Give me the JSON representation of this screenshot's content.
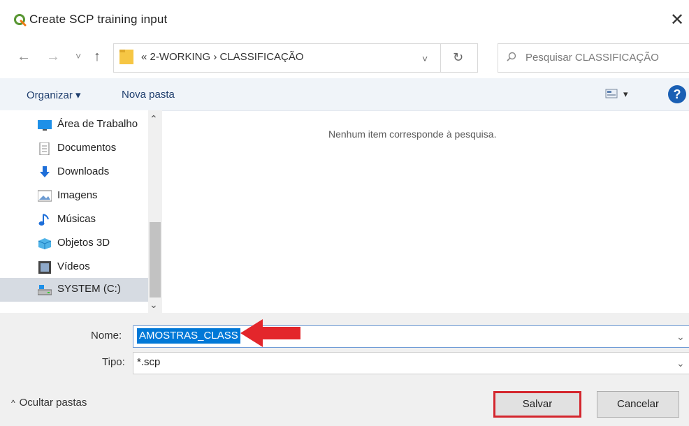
{
  "window": {
    "title": "Create SCP training input",
    "close_glyph": "✕"
  },
  "nav": {
    "back": "←",
    "forward": "→",
    "recent": "˅",
    "up": "↑"
  },
  "address": {
    "breadcrumb": "« 2-WORKING  ›  CLASSIFICAÇÃO",
    "dropdown_glyph": "˅",
    "refresh_glyph": "↻",
    "search_placeholder": "Pesquisar CLASSIFICAÇÃO"
  },
  "toolbar": {
    "organize_label": "Organizar ▾",
    "new_folder_label": "Nova pasta",
    "view_dropdown": "▾",
    "help_glyph": "?"
  },
  "sidebar": {
    "items": [
      {
        "label": "Área de Trabalho",
        "icon": "desktop-icon"
      },
      {
        "label": "Documentos",
        "icon": "documents-icon"
      },
      {
        "label": "Downloads",
        "icon": "downloads-icon"
      },
      {
        "label": "Imagens",
        "icon": "images-icon"
      },
      {
        "label": "Músicas",
        "icon": "music-icon"
      },
      {
        "label": "Objetos 3D",
        "icon": "objects-3d-icon"
      },
      {
        "label": "Vídeos",
        "icon": "videos-icon"
      },
      {
        "label": "SYSTEM (C:)",
        "icon": "drive-icon",
        "selected": true
      }
    ]
  },
  "content": {
    "empty_message": "Nenhum item corresponde à pesquisa."
  },
  "form": {
    "name_label": "Nome:",
    "name_value": "AMOSTRAS_CLASS",
    "type_label": "Tipo:",
    "type_value": "*.scp"
  },
  "footer": {
    "hide_folders": "Ocultar pastas",
    "save_label": "Salvar",
    "cancel_label": "Cancelar"
  },
  "colors": {
    "accent": "#0078d7",
    "highlight_red": "#d4262e",
    "selected_bg": "#d6dbe2"
  }
}
